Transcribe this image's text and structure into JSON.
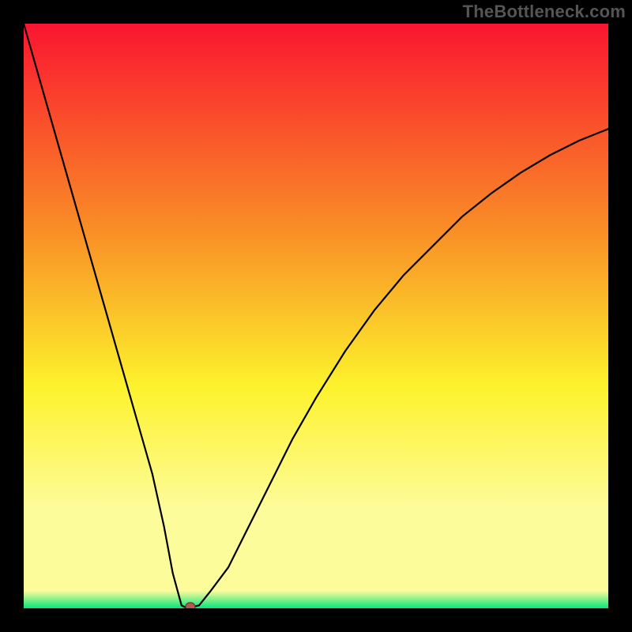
{
  "watermark": "TheBottleneck.com",
  "colors": {
    "frame": "#000000",
    "watermark": "#555555",
    "gradient_top": "#fa1530",
    "gradient_mid1": "#f98d26",
    "gradient_mid2": "#fdf22c",
    "gradient_bottom_yellow": "#fdfc9a",
    "gradient_green": "#03e67a",
    "curve": "#000000",
    "marker_fill": "#b35a50",
    "marker_stroke": "#6a3a33"
  },
  "chart_data": {
    "type": "line",
    "title": "",
    "xlabel": "",
    "ylabel": "",
    "xlim": [
      0,
      100
    ],
    "ylim": [
      0,
      100
    ],
    "x": [
      0,
      2,
      4,
      6,
      8,
      10,
      12,
      14,
      16,
      18,
      20,
      22,
      24,
      25.5,
      27,
      28,
      30,
      32,
      35,
      38,
      42,
      46,
      50,
      55,
      60,
      65,
      70,
      75,
      80,
      85,
      90,
      95,
      100
    ],
    "y": [
      100,
      93,
      86,
      79,
      72,
      65,
      58,
      51,
      44,
      37,
      30,
      23,
      14,
      6,
      0.5,
      0,
      0.5,
      3,
      7,
      13,
      21,
      29,
      36,
      44,
      51,
      57,
      62,
      67,
      71,
      74.5,
      77.5,
      80,
      82
    ],
    "marker": {
      "x": 28.5,
      "y": 0.3
    }
  }
}
